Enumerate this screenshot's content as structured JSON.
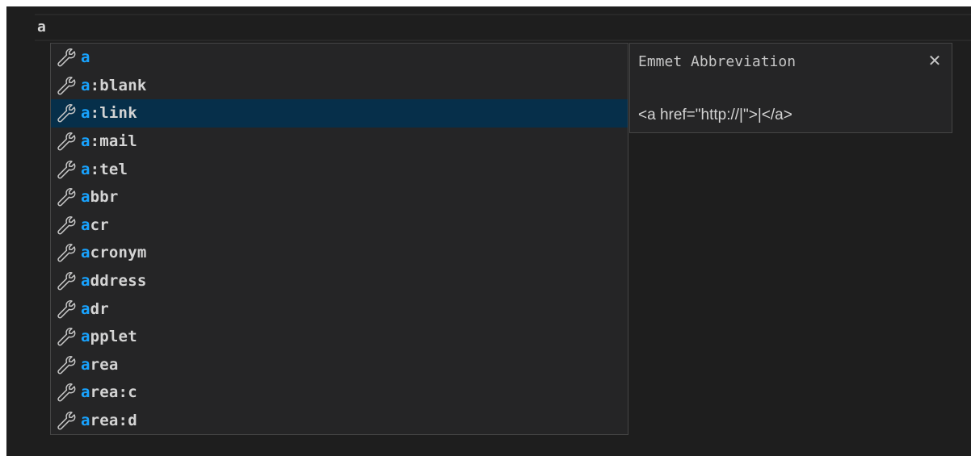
{
  "editor": {
    "line_text": "a"
  },
  "suggestions": {
    "selected_index": 2,
    "items": [
      {
        "match": "a",
        "rest": ""
      },
      {
        "match": "a",
        "rest": ":blank"
      },
      {
        "match": "a",
        "rest": ":link"
      },
      {
        "match": "a",
        "rest": ":mail"
      },
      {
        "match": "a",
        "rest": ":tel"
      },
      {
        "match": "a",
        "rest": "bbr"
      },
      {
        "match": "a",
        "rest": "cr"
      },
      {
        "match": "a",
        "rest": "cronym"
      },
      {
        "match": "a",
        "rest": "ddress"
      },
      {
        "match": "a",
        "rest": "dr"
      },
      {
        "match": "a",
        "rest": "pplet"
      },
      {
        "match": "a",
        "rest": "rea"
      },
      {
        "match": "a",
        "rest": "rea:c"
      },
      {
        "match": "a",
        "rest": "rea:d"
      }
    ],
    "item_icon": "wrench-icon"
  },
  "details": {
    "title": "Emmet Abbreviation",
    "close_glyph": "✕",
    "body": "<a href=\"http://|\">|</a>"
  },
  "colors": {
    "editor_bg": "#1e1e1e",
    "widget_bg": "#252526",
    "selected_bg": "#062f4a",
    "match_highlight": "#18a3ff",
    "text": "#d4d4d4"
  }
}
